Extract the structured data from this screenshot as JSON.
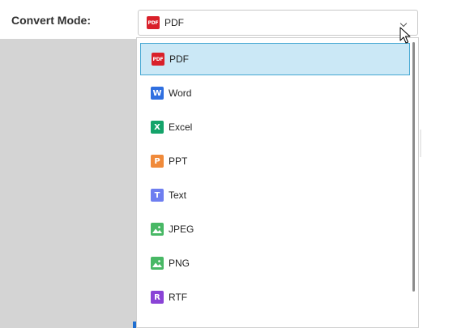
{
  "form": {
    "label": "Convert Mode:",
    "selected": {
      "label": "PDF",
      "icon": "pdf-icon",
      "icon_text": "PDF",
      "color": "#d9202a"
    }
  },
  "dropdown": {
    "options": [
      {
        "label": "PDF",
        "icon": "pdf-icon",
        "icon_text": "PDF",
        "color": "#d9202a",
        "selected": true
      },
      {
        "label": "Word",
        "icon": "word-icon",
        "icon_text": "W",
        "color": "#2f6fe0",
        "selected": false
      },
      {
        "label": "Excel",
        "icon": "excel-icon",
        "icon_text": "X",
        "color": "#14a36a",
        "selected": false
      },
      {
        "label": "PPT",
        "icon": "ppt-icon",
        "icon_text": "P",
        "color": "#f08a3a",
        "selected": false
      },
      {
        "label": "Text",
        "icon": "text-icon",
        "icon_text": "T",
        "color": "#6e7ef0",
        "selected": false
      },
      {
        "label": "JPEG",
        "icon": "jpeg-image-icon",
        "icon_text": "",
        "color": "#48b865",
        "selected": false
      },
      {
        "label": "PNG",
        "icon": "png-image-icon",
        "icon_text": "",
        "color": "#48b865",
        "selected": false
      },
      {
        "label": "RTF",
        "icon": "rtf-icon",
        "icon_text": "R",
        "color": "#8a43d6",
        "selected": false
      }
    ]
  },
  "colors": {
    "selection_bg": "#cbe8f6",
    "selection_border": "#44a7d2",
    "backdrop": "#d4d4d4"
  }
}
